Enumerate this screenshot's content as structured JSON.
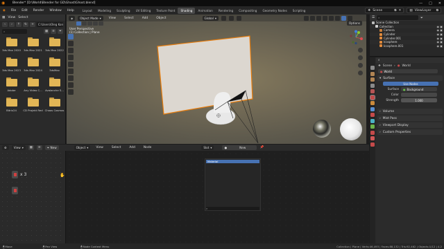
{
  "window": {
    "title": "Blender* [D:\\World\\Blender for GD\\Ghost\\Ghost.blend]",
    "controls": [
      "—",
      "□",
      "✕"
    ]
  },
  "menu": [
    "File",
    "Edit",
    "Render",
    "Window",
    "Help"
  ],
  "workspaces": [
    "Layout",
    "Modeling",
    "Sculpting",
    "UV Editing",
    "Texture Paint",
    "Shading",
    "Animation",
    "Rendering",
    "Compositing",
    "Geometry Nodes",
    "Scripting"
  ],
  "active_workspace": "Shading",
  "scene": "Scene",
  "view_layer": "ViewLayer",
  "file_browser": {
    "header": [
      "View",
      "Select"
    ],
    "path": "C:\\Users\\Oleg Koron...",
    "search_placeholder": "",
    "folders": [
      "3ds Max 2020",
      "3ds Max 2021",
      "3ds Max 2022",
      "3ds Max 2023",
      "3ds Max 2024",
      "3dsMax",
      "Adobe",
      "Any Video C...",
      "Avalanche S...",
      "Bitrix24",
      "CD Projekt Red",
      "Chaos Cosmos"
    ]
  },
  "viewport": {
    "mode": "Object Mode",
    "menus": [
      "View",
      "Select",
      "Add",
      "Object"
    ],
    "transform": "Global",
    "info_line1": "User Perspective",
    "info_line2": "(1) Collection | Plane",
    "options": "Options"
  },
  "outliner": {
    "root": "Scene Collection",
    "items": [
      {
        "name": "Collection",
        "color": "#cfcfcf"
      },
      {
        "name": "Camera",
        "color": "#c77e3a"
      },
      {
        "name": "Cylinder",
        "color": "#e08a3c"
      },
      {
        "name": "Cylinder.001",
        "color": "#e08a3c"
      },
      {
        "name": "Icosphere",
        "color": "#e08a3c"
      },
      {
        "name": "Icosphere.001",
        "color": "#e08a3c"
      }
    ]
  },
  "properties": {
    "scene_label": "Scene",
    "world_label": "World",
    "world_name": "World",
    "surface_header": "Surface",
    "use_nodes": "Use Nodes",
    "surface_label": "Surface",
    "surface_value": "Background",
    "color_label": "Color",
    "strength_label": "Strength",
    "strength_value": "1.000",
    "sections": [
      "Volume",
      "Mist Pass",
      "Viewport Display",
      "Custom Properties"
    ]
  },
  "node_editor": {
    "object_type": "Object",
    "menus": [
      "View",
      "Select",
      "Add",
      "Node"
    ],
    "slot": "Slot",
    "new_button": "New",
    "material_slot": "Material",
    "count_badge": "x 3"
  },
  "status_bar": {
    "left": [
      "Move",
      "Pan View",
      "Node Context Menu"
    ],
    "right": "Collection | Plane | Verts:46,493 | Faces:88,132 | Tris:92,462 | Objects:1/12 | 4.2"
  },
  "colors": {
    "accent": "#4772b3",
    "selection": "#e87d0d",
    "folder": "#e2b656"
  }
}
